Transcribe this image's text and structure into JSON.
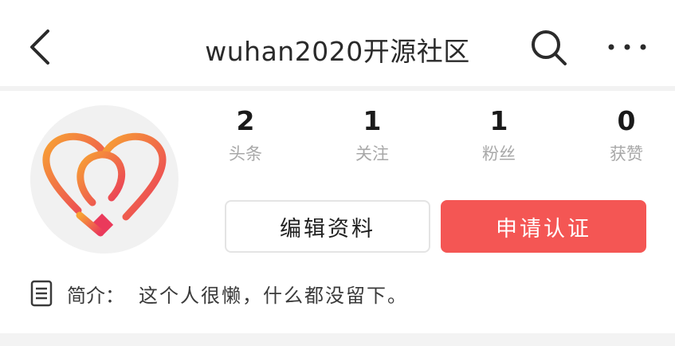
{
  "header": {
    "title": "wuhan2020开源社区"
  },
  "stats": [
    {
      "value": "2",
      "label": "头条"
    },
    {
      "value": "1",
      "label": "关注"
    },
    {
      "value": "1",
      "label": "粉丝"
    },
    {
      "value": "0",
      "label": "获赞"
    }
  ],
  "buttons": {
    "edit_label": "编辑资料",
    "verify_label": "申请认证"
  },
  "bio": {
    "label": "简介：",
    "text": "这个人很懒，什么都没留下。"
  },
  "icons": {
    "back": "chevron-left-icon",
    "search": "search-icon",
    "more": "more-dots-icon",
    "bio": "document-icon"
  },
  "colors": {
    "accent": "#f45654",
    "logo_gradient_start": "#f7a234",
    "logo_gradient_end": "#ea3a5b"
  }
}
